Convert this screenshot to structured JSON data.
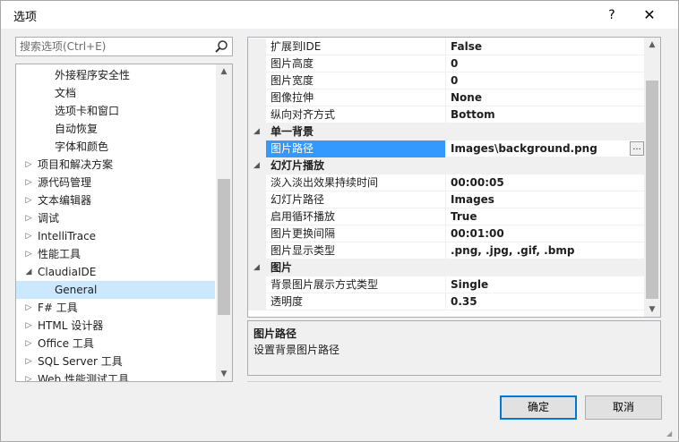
{
  "window": {
    "title": "选项",
    "help_label": "?",
    "close_label": "✕"
  },
  "search": {
    "placeholder": "搜索选项(Ctrl+E)"
  },
  "tree": {
    "items": [
      {
        "label": "外接程序安全性",
        "level": 2,
        "expander": ""
      },
      {
        "label": "文档",
        "level": 2,
        "expander": ""
      },
      {
        "label": "选项卡和窗口",
        "level": 2,
        "expander": ""
      },
      {
        "label": "自动恢复",
        "level": 2,
        "expander": ""
      },
      {
        "label": "字体和颜色",
        "level": 2,
        "expander": ""
      },
      {
        "label": "项目和解决方案",
        "level": 1,
        "expander": "collapsed"
      },
      {
        "label": "源代码管理",
        "level": 1,
        "expander": "collapsed"
      },
      {
        "label": "文本编辑器",
        "level": 1,
        "expander": "collapsed"
      },
      {
        "label": "调试",
        "level": 1,
        "expander": "collapsed"
      },
      {
        "label": "IntelliTrace",
        "level": 1,
        "expander": "collapsed"
      },
      {
        "label": "性能工具",
        "level": 1,
        "expander": "collapsed"
      },
      {
        "label": "ClaudiaIDE",
        "level": 1,
        "expander": "expanded"
      },
      {
        "label": "General",
        "level": 2,
        "expander": "",
        "selected": true
      },
      {
        "label": "F# 工具",
        "level": 1,
        "expander": "collapsed"
      },
      {
        "label": "HTML 设计器",
        "level": 1,
        "expander": "collapsed"
      },
      {
        "label": "Office 工具",
        "level": 1,
        "expander": "collapsed"
      },
      {
        "label": "SQL Server 工具",
        "level": 1,
        "expander": "collapsed"
      },
      {
        "label": "Web 性能测试工具",
        "level": 1,
        "expander": "collapsed"
      }
    ]
  },
  "grid": {
    "rows": [
      {
        "type": "prop",
        "name": "扩展到IDE",
        "value": "False"
      },
      {
        "type": "prop",
        "name": "图片高度",
        "value": "0"
      },
      {
        "type": "prop",
        "name": "图片宽度",
        "value": "0"
      },
      {
        "type": "prop",
        "name": "图像拉伸",
        "value": "None"
      },
      {
        "type": "prop",
        "name": "纵向对齐方式",
        "value": "Bottom"
      },
      {
        "type": "category",
        "name": "单一背景"
      },
      {
        "type": "prop",
        "name": "图片路径",
        "value": "Images\\background.png",
        "selected": true,
        "browse": "..."
      },
      {
        "type": "category",
        "name": "幻灯片播放"
      },
      {
        "type": "prop",
        "name": "淡入淡出效果持续时间",
        "value": "00:00:05"
      },
      {
        "type": "prop",
        "name": "幻灯片路径",
        "value": "Images"
      },
      {
        "type": "prop",
        "name": "启用循环播放",
        "value": "True"
      },
      {
        "type": "prop",
        "name": "图片更换间隔",
        "value": "00:01:00"
      },
      {
        "type": "prop",
        "name": "图片显示类型",
        "value": ".png, .jpg, .gif, .bmp"
      },
      {
        "type": "category",
        "name": "图片"
      },
      {
        "type": "prop",
        "name": "背景图片展示方式类型",
        "value": "Single"
      },
      {
        "type": "prop",
        "name": "透明度",
        "value": "0.35"
      }
    ]
  },
  "description": {
    "title": "图片路径",
    "text": "设置背景图片路径"
  },
  "buttons": {
    "ok": "确定",
    "cancel": "取消"
  },
  "icons": {
    "search": "search-icon",
    "expand": "chevron-right-icon",
    "collapse": "chevron-down-icon"
  }
}
